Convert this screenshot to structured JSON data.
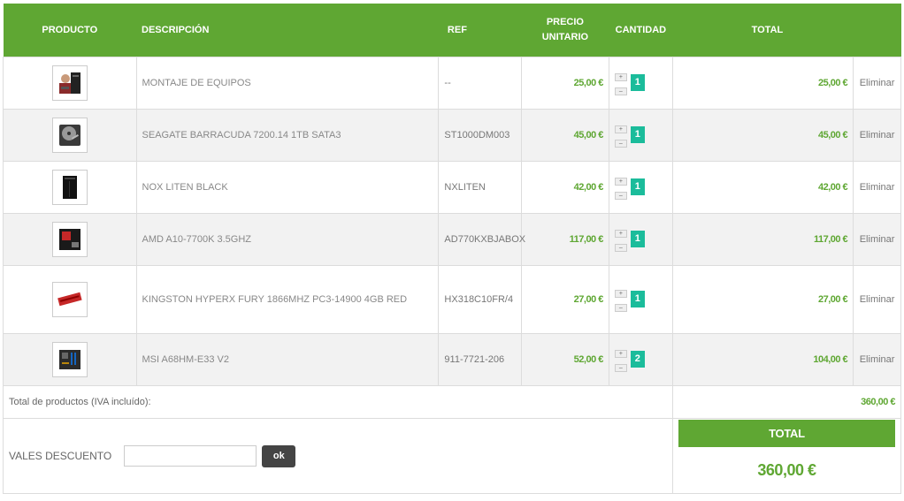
{
  "headers": {
    "product": "PRODUCTO",
    "description": "DESCRIPCIÓN",
    "ref": "REF",
    "unit_price_line1": "PRECIO",
    "unit_price_line2": "UNITARIO",
    "quantity": "CANTIDAD",
    "total": "TOTAL"
  },
  "items": [
    {
      "description": "MONTAJE DE EQUIPOS",
      "ref": "--",
      "unit_price": "25,00 €",
      "quantity": "1",
      "total": "25,00 €",
      "remove_label": "Eliminar",
      "thumb": "pc-assembly-image"
    },
    {
      "description": "SEAGATE BARRACUDA 7200.14 1TB SATA3",
      "ref": "ST1000DM003",
      "unit_price": "45,00 €",
      "quantity": "1",
      "total": "45,00 €",
      "remove_label": "Eliminar",
      "thumb": "hard-drive-image"
    },
    {
      "description": "NOX LITEN BLACK",
      "ref": "NXLITEN",
      "unit_price": "42,00 €",
      "quantity": "1",
      "total": "42,00 €",
      "remove_label": "Eliminar",
      "thumb": "pc-case-image"
    },
    {
      "description": "AMD A10-7700K 3.5GHZ",
      "ref": "AD770KXBJABOX",
      "unit_price": "117,00 €",
      "quantity": "1",
      "total": "117,00 €",
      "remove_label": "Eliminar",
      "thumb": "cpu-box-image"
    },
    {
      "description": "KINGSTON HYPERX FURY 1866MHZ PC3-14900 4GB RED",
      "ref": "HX318C10FR/4",
      "unit_price": "27,00 €",
      "quantity": "1",
      "total": "27,00 €",
      "remove_label": "Eliminar",
      "thumb": "ram-module-image"
    },
    {
      "description": "MSI A68HM-E33 V2",
      "ref": "911-7721-206",
      "unit_price": "52,00 €",
      "quantity": "2",
      "total": "104,00 €",
      "remove_label": "Eliminar",
      "thumb": "motherboard-image"
    }
  ],
  "summary": {
    "products_total_label": "Total de productos (IVA incluído):",
    "products_total_value": "360,00 €"
  },
  "voucher": {
    "label": "VALES DESCUENTO",
    "input_value": "",
    "button_label": "ok"
  },
  "grand_total": {
    "label": "TOTAL",
    "value": "360,00 €"
  },
  "colors": {
    "accent": "#5fa733",
    "quantity_badge": "#1bbc9b"
  }
}
